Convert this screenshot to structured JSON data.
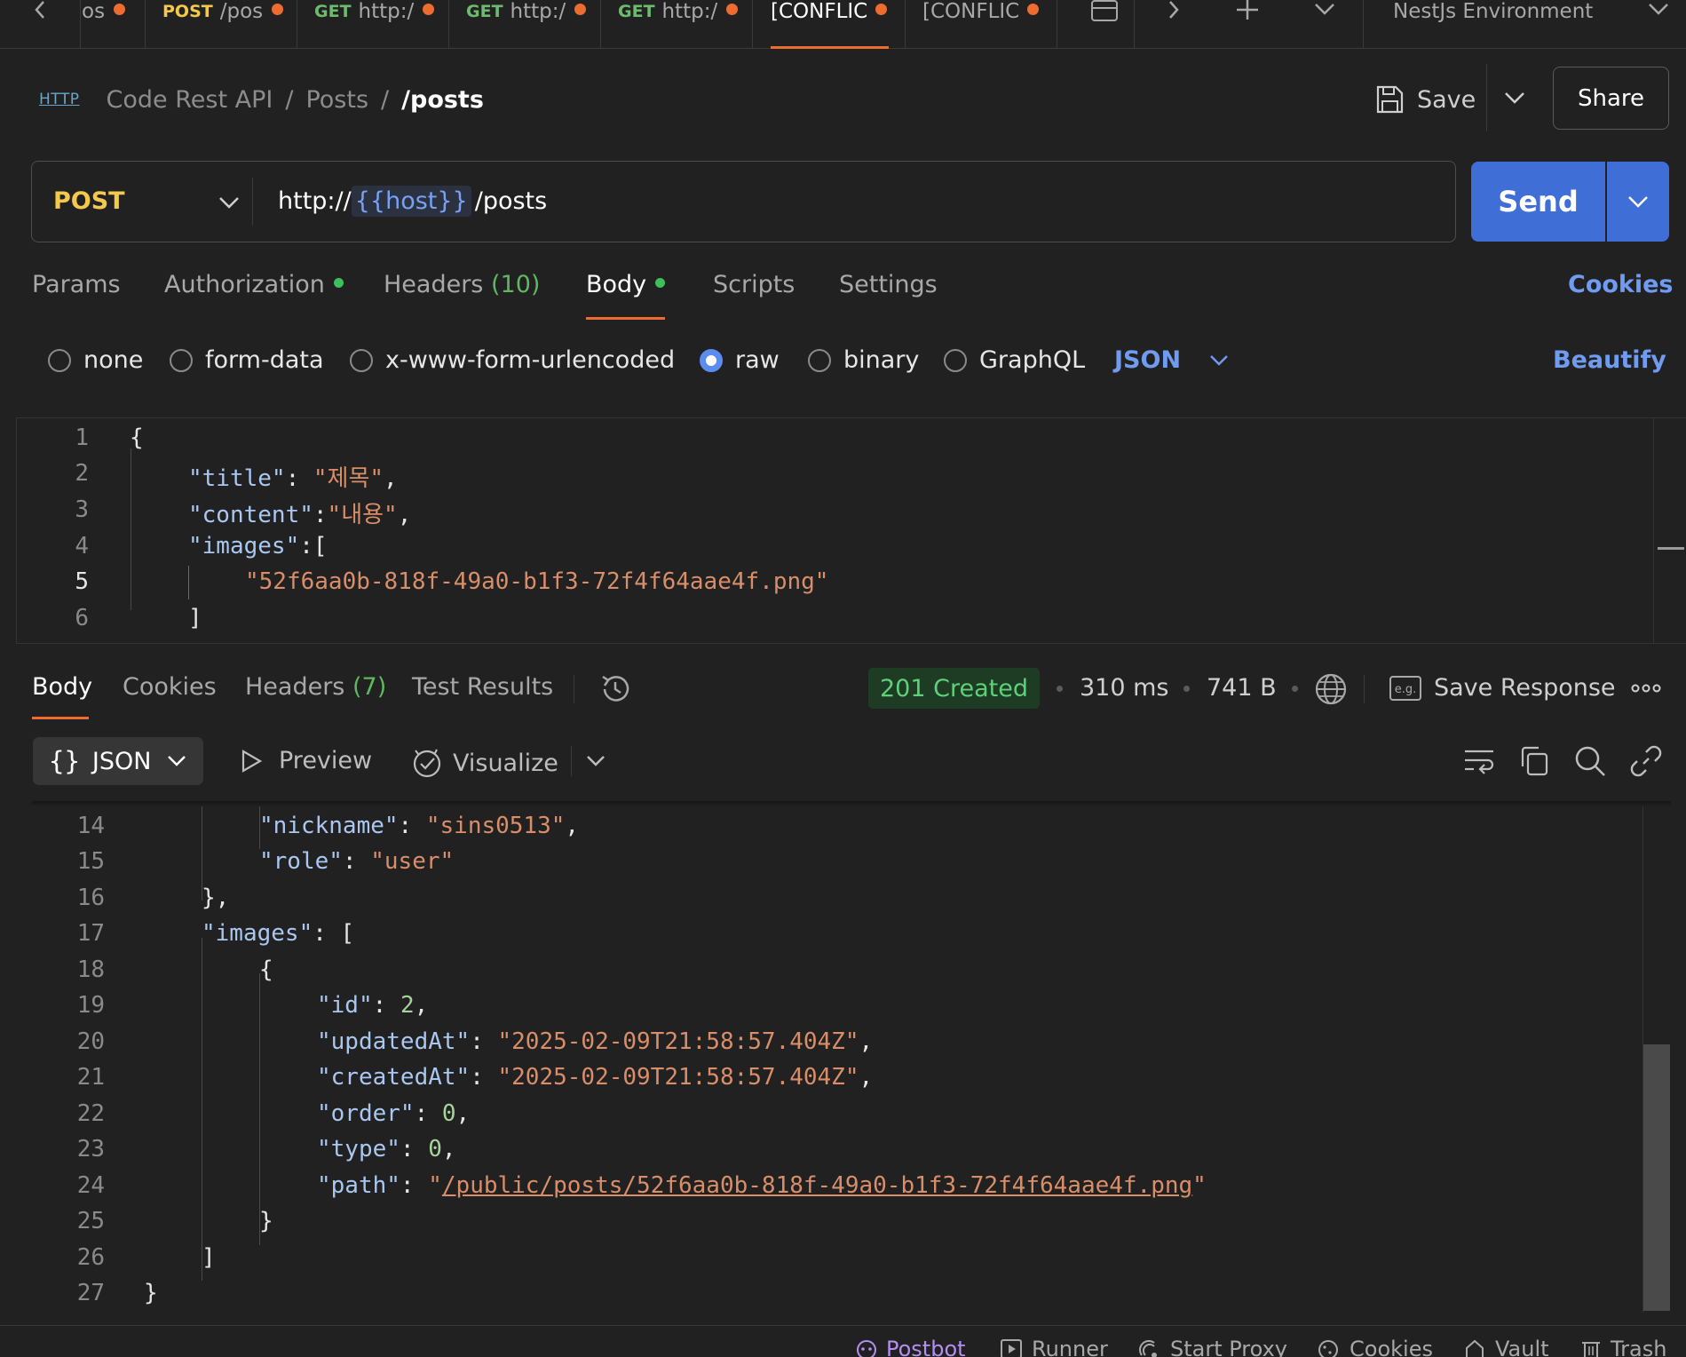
{
  "tabs": [
    {
      "method": "",
      "label": "os",
      "dirty": true
    },
    {
      "method": "POST",
      "label": "/pos",
      "dirty": true
    },
    {
      "method": "GET",
      "label": "http:/",
      "dirty": true
    },
    {
      "method": "GET",
      "label": "http:/",
      "dirty": true
    },
    {
      "method": "GET",
      "label": "http:/",
      "dirty": true
    },
    {
      "method": "",
      "label": "[CONFLIC",
      "dirty": true,
      "active": true
    },
    {
      "method": "",
      "label": "[CONFLIC",
      "dirty": true
    }
  ],
  "environment": "NestJs Environment",
  "breadcrumb": {
    "badge": "HTTP",
    "collection": "Code Rest API",
    "folder": "Posts",
    "request": "/posts"
  },
  "actions": {
    "save": "Save",
    "share": "Share"
  },
  "request": {
    "method": "POST",
    "url_prefix": "http://",
    "url_var": "{{host}}",
    "url_suffix": "/posts",
    "send": "Send"
  },
  "request_tabs": {
    "params": "Params",
    "authorization": "Authorization",
    "headers": "Headers",
    "headers_count": "(10)",
    "body": "Body",
    "scripts": "Scripts",
    "settings": "Settings",
    "cookies": "Cookies"
  },
  "body_types": {
    "none": "none",
    "form_data": "form-data",
    "urlencoded": "x-www-form-urlencoded",
    "raw": "raw",
    "binary": "binary",
    "graphql": "GraphQL",
    "format": "JSON",
    "beautify": "Beautify",
    "selected": "raw"
  },
  "request_body": {
    "line_numbers": [
      "1",
      "2",
      "3",
      "4",
      "5",
      "6"
    ],
    "l1": "{",
    "l2_key": "\"title\"",
    "l2_val": "\"제목\"",
    "l3_key": "\"content\"",
    "l3_val": "\"내용\"",
    "l4_key": "\"images\"",
    "l4_val": "[",
    "l5_val": "\"52f6aa0b-818f-49a0-b1f3-72f4f64aae4f.png\"",
    "l6": "]"
  },
  "response_tabs": {
    "body": "Body",
    "cookies": "Cookies",
    "headers": "Headers",
    "headers_count": "(7)",
    "test_results": "Test Results"
  },
  "response_meta": {
    "status": "201 Created",
    "time": "310 ms",
    "size": "741 B",
    "save_response": "Save Response"
  },
  "response_toolbar": {
    "format": "JSON",
    "preview": "Preview",
    "visualize": "Visualize"
  },
  "response_body": {
    "line_numbers": [
      "14",
      "15",
      "16",
      "17",
      "18",
      "19",
      "20",
      "21",
      "22",
      "23",
      "24",
      "25",
      "26",
      "27"
    ],
    "l14_key": "\"nickname\"",
    "l14_val": "\"sins0513\"",
    "l15_key": "\"role\"",
    "l15_val": "\"user\"",
    "l16": "},",
    "l17_key": "\"images\"",
    "l17_val": "[",
    "l18": "{",
    "l19_key": "\"id\"",
    "l19_val": "2",
    "l20_key": "\"updatedAt\"",
    "l20_val": "\"2025-02-09T21:58:57.404Z\"",
    "l21_key": "\"createdAt\"",
    "l21_val": "\"2025-02-09T21:58:57.404Z\"",
    "l22_key": "\"order\"",
    "l22_val": "0",
    "l23_key": "\"type\"",
    "l23_val": "0",
    "l24_key": "\"path\"",
    "l24_val": "/public/posts/52f6aa0b-818f-49a0-b1f3-72f4f64aae4f.png",
    "l25": "}",
    "l26": "]",
    "l27": "}"
  },
  "status_bar": {
    "postbot": "Postbot",
    "runner": "Runner",
    "proxy": "Start Proxy",
    "cookies": "Cookies",
    "vault": "Vault",
    "trash": "Trash"
  },
  "colors": {
    "accent": "#ed6c2f",
    "send": "#3f6ed7",
    "status_ok": "#5fd07a",
    "method_post": "#f4c84a",
    "link": "#6f9bf0"
  }
}
